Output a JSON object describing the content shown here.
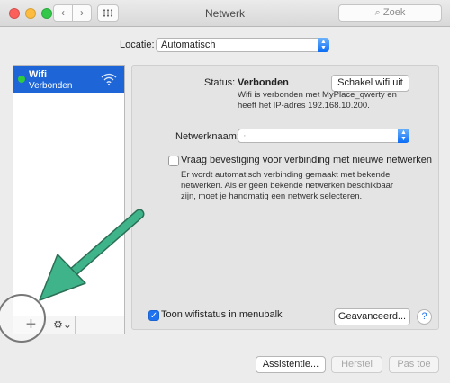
{
  "window": {
    "title": "Netwerk",
    "back_glyph": "‹",
    "forward_glyph": "›",
    "search_placeholder": "Zoek",
    "search_icon": "⌕"
  },
  "location": {
    "label": "Locatie:",
    "value": "Automatisch"
  },
  "sidebar": {
    "items": [
      {
        "name": "Wifi",
        "status": "Verbonden",
        "dot_color": "#2fcc3c",
        "icon": "wifi-icon"
      }
    ],
    "add_glyph": "+",
    "gear_glyph": "⚙⌄"
  },
  "detail": {
    "status_label": "Status:",
    "status_value": "Verbonden",
    "wifi_off_button": "Schakel wifi uit",
    "status_description": "Wifi is verbonden met MyPlace_qwerty en heeft het IP-adres 192.168.10.200.",
    "network_name_label": "Netwerknaam:",
    "network_name_value": "·",
    "ask_label": "Vraag bevestiging voor verbinding met nieuwe netwerken",
    "ask_checked": false,
    "ask_description": "Er wordt automatisch verbinding gemaakt met bekende netwerken. Als er geen bekende netwerken beschikbaar zijn, moet je handmatig een netwerk selecteren.",
    "show_status_label": "Toon wifistatus in menubalk",
    "show_status_checked": true,
    "advanced_button": "Geavanceerd...",
    "help_glyph": "?"
  },
  "footer": {
    "assistant_button": "Assistentie...",
    "restore_button": "Herstel",
    "apply_button": "Pas toe"
  },
  "colors": {
    "selection": "#1e66d8",
    "arrow": "#3fb48a",
    "accent": "#1f73f0"
  }
}
